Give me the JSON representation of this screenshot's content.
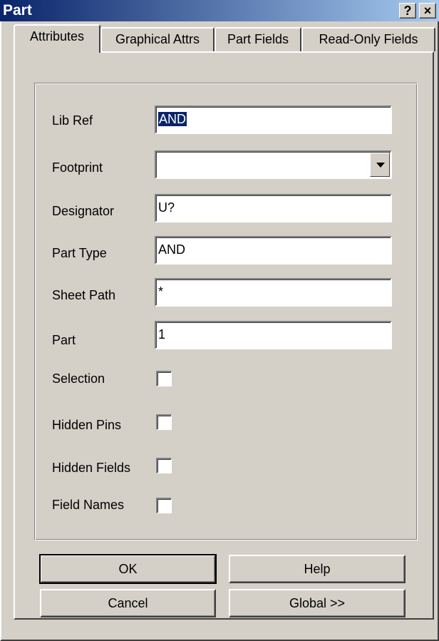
{
  "window": {
    "title": "Part",
    "help_glyph": "?",
    "close_glyph": "×"
  },
  "tabs": [
    {
      "label": "Attributes",
      "active": true
    },
    {
      "label": "Graphical Attrs",
      "active": false
    },
    {
      "label": "Part Fields",
      "active": false
    },
    {
      "label": "Read-Only Fields",
      "active": false
    }
  ],
  "fields": {
    "lib_ref": {
      "label": "Lib Ref",
      "value": "AND"
    },
    "footprint": {
      "label": "Footprint",
      "value": ""
    },
    "designator": {
      "label": "Designator",
      "value": "U?"
    },
    "part_type": {
      "label": "Part Type",
      "value": "AND"
    },
    "sheet_path": {
      "label": "Sheet Path",
      "value": "*"
    },
    "part": {
      "label": "Part",
      "value": "1"
    }
  },
  "checkboxes": {
    "selection": {
      "label": "Selection",
      "checked": false
    },
    "hidden_pins": {
      "label": "Hidden Pins",
      "checked": false
    },
    "hidden_fields": {
      "label": "Hidden Fields",
      "checked": false
    },
    "field_names": {
      "label": "Field Names",
      "checked": false
    }
  },
  "buttons": {
    "ok": "OK",
    "help": "Help",
    "cancel": "Cancel",
    "global": "Global >>"
  },
  "colors": {
    "face": "#d4d0c8",
    "title_start": "#0a246a",
    "title_end": "#a6caf0",
    "selection": "#0a246a"
  }
}
